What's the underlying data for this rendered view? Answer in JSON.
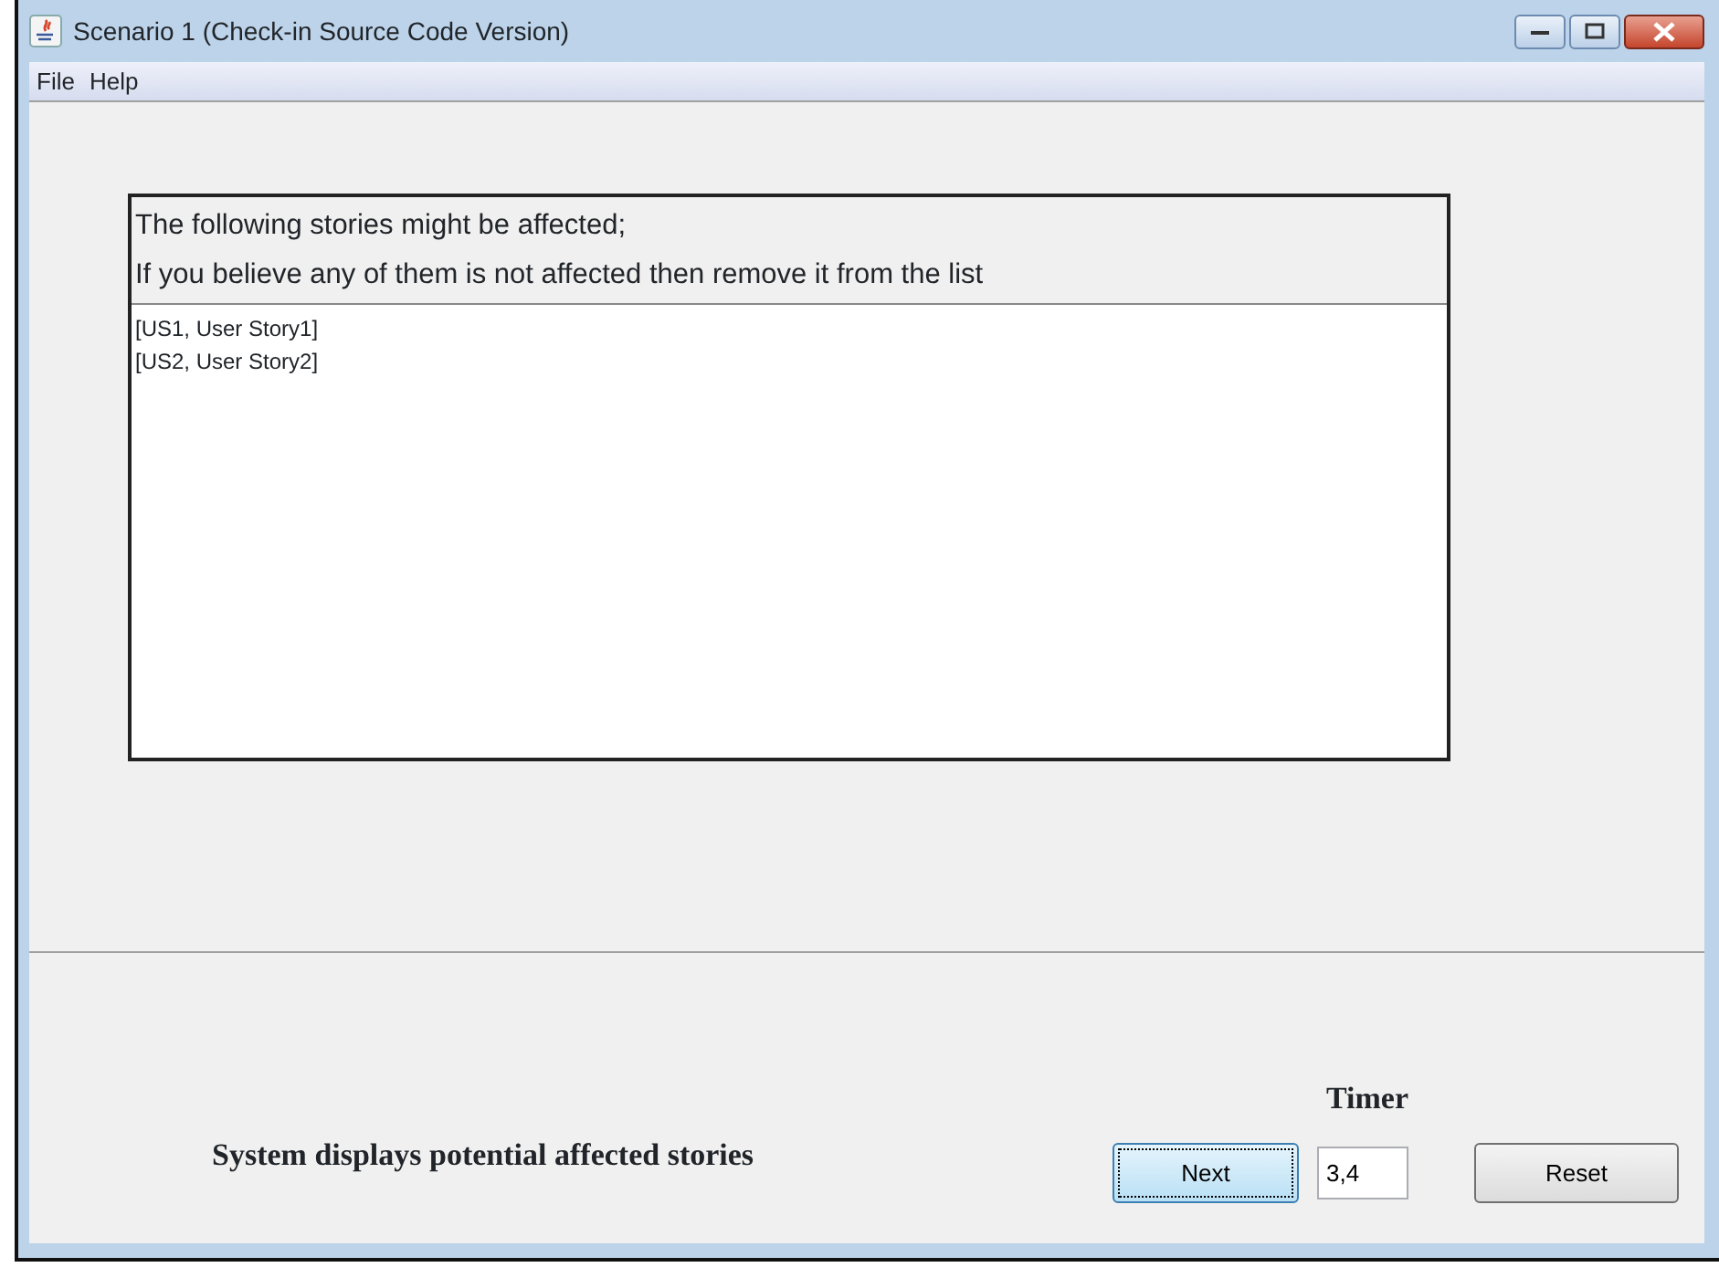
{
  "window": {
    "title": "Scenario 1 (Check-in Source Code Version)"
  },
  "menu": [
    "File",
    "Help"
  ],
  "prompt_lines": [
    "The following stories might be affected;",
    "If you believe any of them is not affected then remove it from the list"
  ],
  "stories": [
    "[US1, User Story1]",
    "[US2, User Story2]"
  ],
  "step_text": "System displays potential affected stories",
  "timer": {
    "label": "Timer",
    "value": "3,4"
  },
  "buttons": [
    {
      "label": "Next",
      "focused": true
    },
    {
      "label": "Reset",
      "focused": false
    }
  ]
}
